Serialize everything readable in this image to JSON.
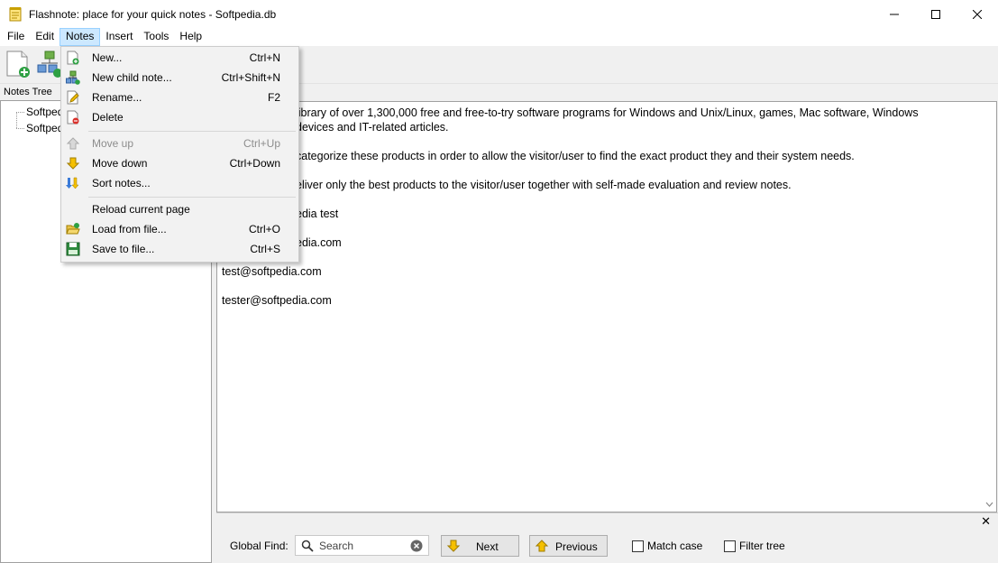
{
  "window": {
    "title": "Flashnote: place for your quick notes - Softpedia.db"
  },
  "menubar": {
    "items": [
      "File",
      "Edit",
      "Notes",
      "Insert",
      "Tools",
      "Help"
    ]
  },
  "tree": {
    "header": "Notes Tree",
    "items": [
      "Softpedia",
      "Softpedia"
    ]
  },
  "notes_menu": {
    "items": [
      {
        "label": "New...",
        "shortcut": "Ctrl+N",
        "icon": "new-note-icon",
        "enabled": true
      },
      {
        "label": "New child note...",
        "shortcut": "Ctrl+Shift+N",
        "icon": "child-note-icon",
        "enabled": true
      },
      {
        "label": "Rename...",
        "shortcut": "F2",
        "icon": "rename-icon",
        "enabled": true
      },
      {
        "label": "Delete",
        "shortcut": "",
        "icon": "delete-note-icon",
        "enabled": true
      },
      {
        "label": "Move up",
        "shortcut": "Ctrl+Up",
        "icon": "arrow-up-icon",
        "enabled": false
      },
      {
        "label": "Move down",
        "shortcut": "Ctrl+Down",
        "icon": "arrow-down-icon",
        "enabled": true
      },
      {
        "label": "Sort notes...",
        "shortcut": "",
        "icon": "sort-icon",
        "enabled": true
      },
      {
        "label": "Reload current page",
        "shortcut": "",
        "icon": "",
        "enabled": true
      },
      {
        "label": "Load from file...",
        "shortcut": "Ctrl+O",
        "icon": "open-folder-icon",
        "enabled": true
      },
      {
        "label": "Save to file...",
        "shortcut": "Ctrl+S",
        "icon": "save-icon",
        "enabled": true
      }
    ]
  },
  "editor": {
    "lines": [
      "library of over 1,300,000 free and free-to-try software programs for Windows and Unix/Linux, games, Mac software, Windows",
      "devices and IT-related articles.",
      "categorize these products in order to allow the visitor/user to find the exact product they and their system needs.",
      "eliver only the best products to the visitor/user together with self-made evaluation and review notes.",
      "edia test",
      "edia.com",
      "test@softpedia.com",
      "tester@softpedia.com"
    ]
  },
  "find": {
    "label": "Global Find:",
    "placeholder": "Search",
    "next_label": "Next",
    "previous_label": "Previous",
    "match_case_label": "Match case",
    "filter_tree_label": "Filter tree",
    "close_glyph": "✕"
  },
  "colors": {
    "menu_active_bg": "#cce8ff",
    "menu_active_border": "#99d1ff",
    "disabled_text": "#8d8d8d",
    "icon_yellow": "#f5c000",
    "icon_green": "#2ea043"
  }
}
